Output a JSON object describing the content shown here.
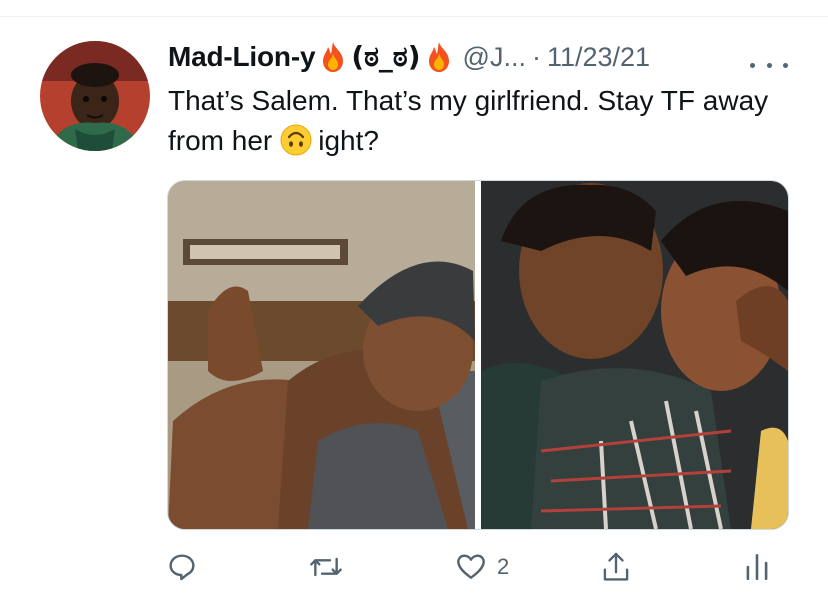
{
  "tweet": {
    "display_name": "Mad-Lion-y",
    "emoticon": "(ಠ_ಠ)",
    "handle": "@J...",
    "separator": "·",
    "timestamp": "11/23/21",
    "text_before_emoji": "That’s Salem. That’s my girlfriend. Stay TF away from her",
    "text_after_emoji": "ight?",
    "icons": {
      "name_emoji_1": "fire-icon",
      "name_emoji_2": "fire-icon",
      "inline_emoji": "upside-down-face-icon",
      "more": "more-icon"
    }
  },
  "actions": {
    "reply": {
      "icon": "reply-icon"
    },
    "retweet": {
      "icon": "retweet-icon"
    },
    "like": {
      "icon": "heart-icon",
      "count": "2"
    },
    "share": {
      "icon": "share-icon"
    },
    "analytics": {
      "icon": "analytics-icon"
    }
  },
  "colors": {
    "text_primary": "#0f1419",
    "text_secondary": "#536471",
    "divider": "#eff3f4"
  }
}
